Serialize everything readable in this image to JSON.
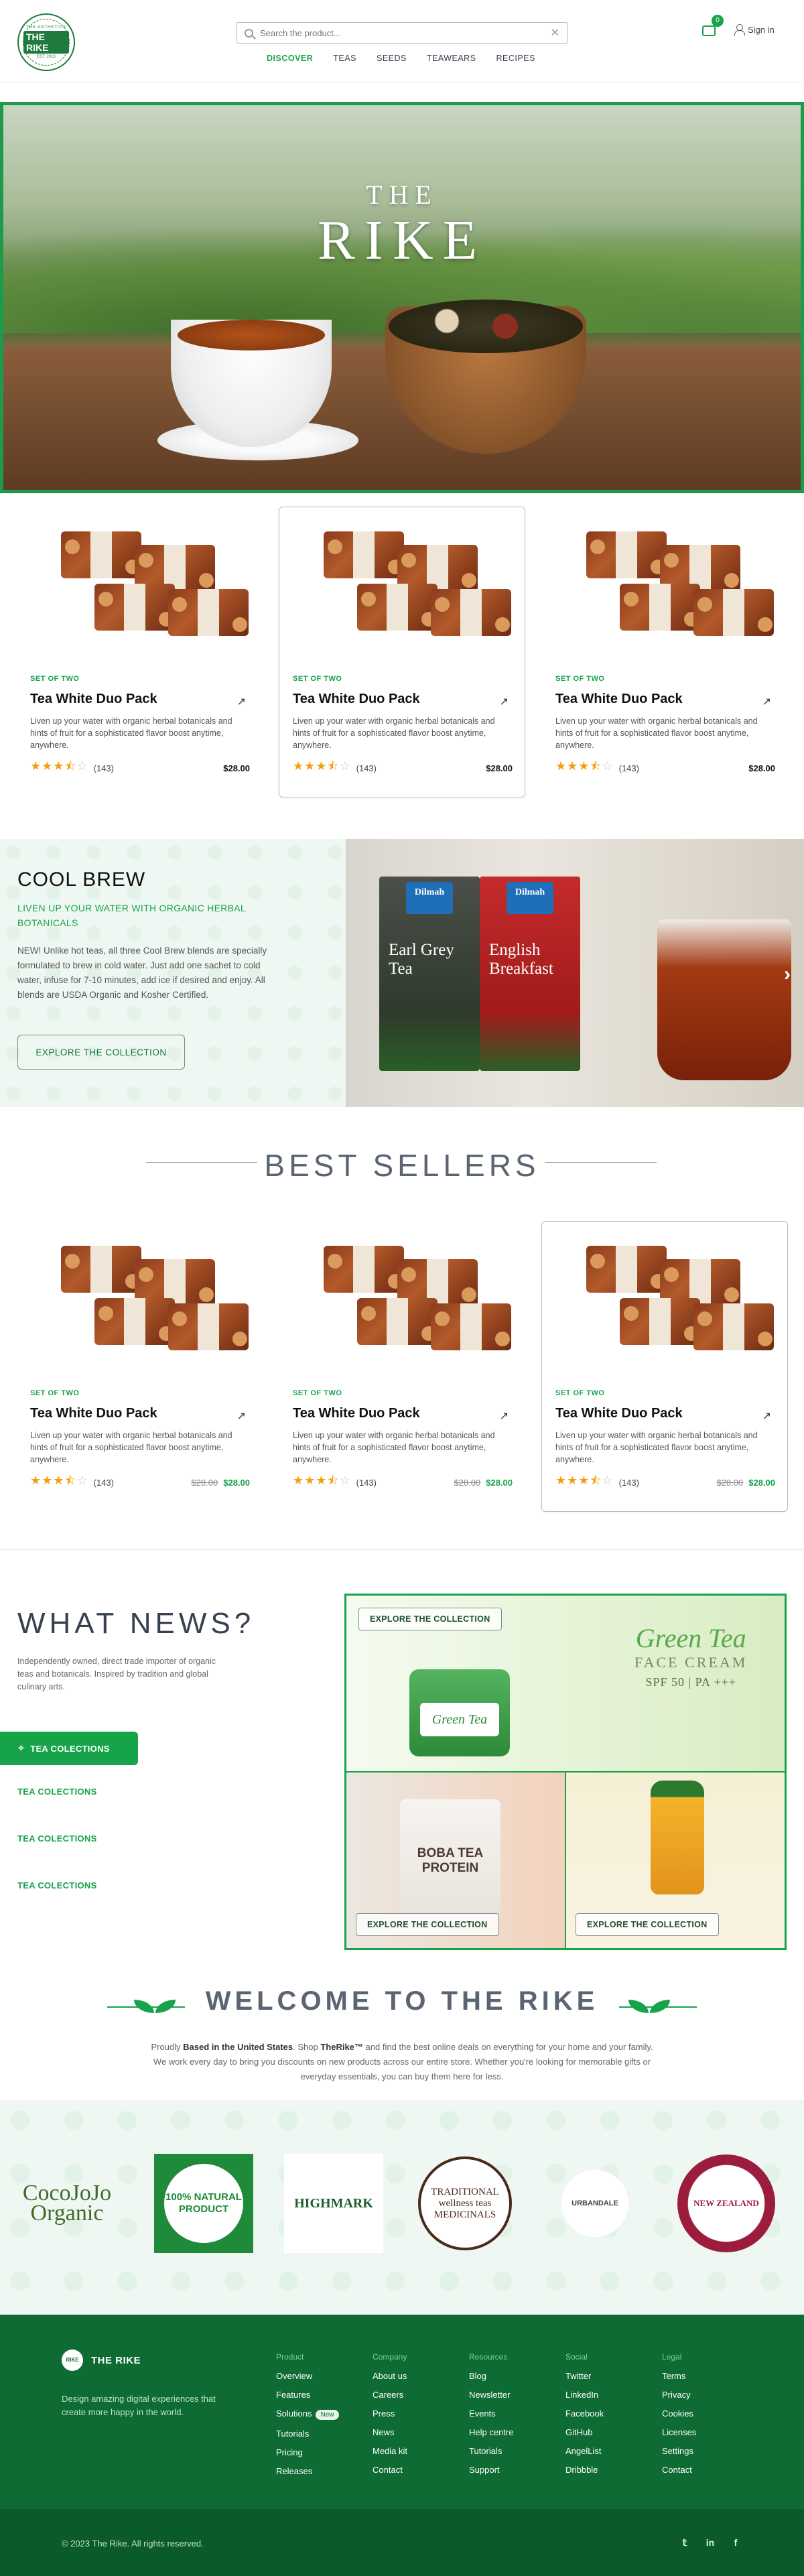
{
  "header": {
    "search_placeholder": "Search the product...",
    "nav": [
      "DISCOVER",
      "TEAS",
      "SEEDS",
      "TEAWEARS",
      "RECIPES"
    ],
    "cart_count": "0",
    "signin": "Sign in",
    "logo_top": "THE ASTHETICS",
    "logo_name": "THE RIKE",
    "logo_est": "EST. 2013"
  },
  "hero": {
    "title_small": "THE",
    "title_large": "RIKE"
  },
  "products_top": [
    {
      "tag": "SET OF TWO",
      "name": "Tea White Duo Pack",
      "desc": "Liven up your water with organic herbal botanicals and hints of fruit for a sophisticated flavor boost anytime, anywhere.",
      "rating": 3.5,
      "count": "(143)",
      "price": "$28.00"
    },
    {
      "tag": "SET OF TWO",
      "name": "Tea White Duo Pack",
      "desc": "Liven up your water with organic herbal botanicals and hints of fruit for a sophisticated flavor boost anytime, anywhere.",
      "rating": 3.5,
      "count": "(143)",
      "price": "$28.00"
    },
    {
      "tag": "SET OF TWO",
      "name": "Tea White Duo Pack",
      "desc": "Liven up your water with organic herbal botanicals and hints of fruit for a sophisticated flavor boost anytime, anywhere.",
      "rating": 3.5,
      "count": "(143)",
      "price": "$28.00"
    }
  ],
  "cool_brew": {
    "title": "COOL BREW",
    "subtitle": "LIVEN UP YOUR WATER WITH ORGANIC HERBAL BOTANICALS",
    "text": "NEW! Unlike hot teas, all three Cool Brew blends are specially formulated to brew in cold water. Just add one sachet to cold water, infuse for 7-10 minutes, add ice if desired and enjoy. All blends are USDA Organic and Kosher Certified.",
    "button": "EXPLORE THE COLLECTION",
    "box1_brand": "Dilmah",
    "box1_name": "Earl Grey Tea",
    "box2_brand": "Dilmah",
    "box2_name": "English Breakfast"
  },
  "best_sellers": {
    "title": "BEST SELLERS",
    "items": [
      {
        "tag": "SET OF TWO",
        "name": "Tea White Duo Pack",
        "desc": "Liven up your water with organic herbal botanicals and hints of fruit for a sophisticated flavor boost anytime, anywhere.",
        "rating": 3.5,
        "count": "(143)",
        "old_price": "$28.00",
        "price": "$28.00"
      },
      {
        "tag": "SET OF TWO",
        "name": "Tea White Duo Pack",
        "desc": "Liven up your water with organic herbal botanicals and hints of fruit for a sophisticated flavor boost anytime, anywhere.",
        "rating": 3.5,
        "count": "(143)",
        "old_price": "$28.00",
        "price": "$28.00"
      },
      {
        "tag": "SET OF TWO",
        "name": "Tea White Duo Pack",
        "desc": "Liven up your water with organic herbal botanicals and hints of fruit for a sophisticated flavor boost anytime, anywhere.",
        "rating": 3.5,
        "count": "(143)",
        "old_price": "$28.00",
        "price": "$28.00"
      }
    ]
  },
  "news": {
    "title": "WHAT NEWS?",
    "desc": "Independently owned, direct trade importer of organic teas and botanicals. Inspired by tradition and global culinary arts.",
    "categories": [
      "TEA COLECTIONS",
      "TEA COLECTIONS",
      "TEA COLECTIONS",
      "TEA COLECTIONS"
    ],
    "button": "EXPLORE THE COLLECTION",
    "gt_title": "Green Tea",
    "gt_sub": "FACE CREAM",
    "gt_spf": "SPF 50 | PA +++",
    "jar_label": "Green Tea",
    "bag_text": "BOBA TEA PROTEIN"
  },
  "welcome": {
    "title": "WELCOME TO THE RIKE",
    "text_pre": "Proudly ",
    "text_bold1": "Based in the United States",
    "text_mid": ". Shop ",
    "text_bold2": "TheRike™",
    "text_post": " and find the best online deals on everything for your home and your family. We work every day to bring you discounts on new products across our entire store. Whether you're looking for memorable gifts or everyday essentials, you can buy them here for less."
  },
  "brands": [
    {
      "name": "CocoJoJo Organic"
    },
    {
      "name": "100% NATURAL PRODUCT"
    },
    {
      "name": "HIGHMARK"
    },
    {
      "name": "TRADITIONAL wellness teas MEDICINALS"
    },
    {
      "name": "URBANDALE"
    },
    {
      "name": "NEW ZEALAND"
    }
  ],
  "footer": {
    "brand": "THE RIKE",
    "desc": "Design amazing digital experiences that create more happy in the world.",
    "columns": [
      {
        "title": "Product",
        "links": [
          "Overview",
          "Features",
          "Solutions",
          "Tutorials",
          "Pricing",
          "Releases"
        ]
      },
      {
        "title": "Company",
        "links": [
          "About us",
          "Careers",
          "Press",
          "News",
          "Media kit",
          "Contact"
        ]
      },
      {
        "title": "Resources",
        "links": [
          "Blog",
          "Newsletter",
          "Events",
          "Help centre",
          "Tutorials",
          "Support"
        ]
      },
      {
        "title": "Social",
        "links": [
          "Twitter",
          "LinkedIn",
          "Facebook",
          "GitHub",
          "AngelList",
          "Dribbble"
        ]
      },
      {
        "title": "Legal",
        "links": [
          "Terms",
          "Privacy",
          "Cookies",
          "Licenses",
          "Settings",
          "Contact"
        ]
      }
    ],
    "new_badge": "New",
    "copyright": "© 2023 The Rike. All rights reserved."
  }
}
